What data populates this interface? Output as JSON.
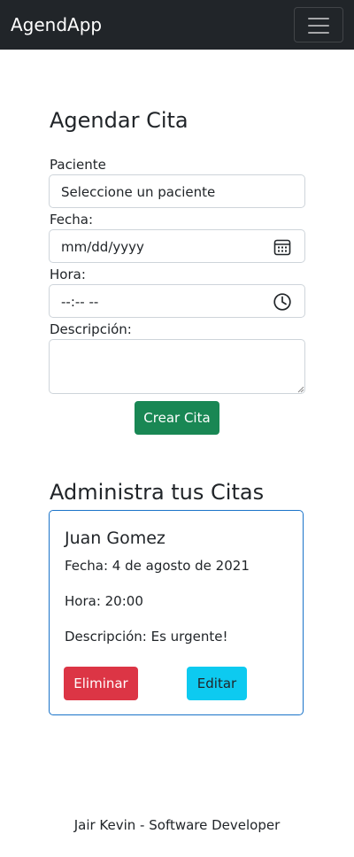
{
  "navbar": {
    "brand": "AgendApp",
    "toggle_icon": "hamburger-menu-icon"
  },
  "form": {
    "title": "Agendar Cita",
    "patient": {
      "label": "Paciente",
      "value": "Seleccione un paciente"
    },
    "date": {
      "label": "Fecha:",
      "value": "mm/dd/yyyy",
      "icon": "calendar-icon"
    },
    "time": {
      "label": "Hora:",
      "value": "--:-- --",
      "icon": "clock-icon"
    },
    "description": {
      "label": "Descripción:",
      "value": ""
    },
    "submit_label": "Crear Cita"
  },
  "list": {
    "title": "Administra tus Citas",
    "appointments": [
      {
        "patient": "Juan Gomez",
        "date": "Fecha: 4 de agosto de 2021",
        "time": "Hora: 20:00",
        "description": "Descripción: Es urgente!",
        "delete_label": "Eliminar",
        "edit_label": "Editar"
      }
    ]
  },
  "footer": {
    "text": "Jair Kevin - Software Developer"
  },
  "colors": {
    "navbar": "#212529",
    "success": "#198754",
    "danger": "#dc3545",
    "info": "#0dcaf0",
    "card_border": "#1a73c9"
  }
}
